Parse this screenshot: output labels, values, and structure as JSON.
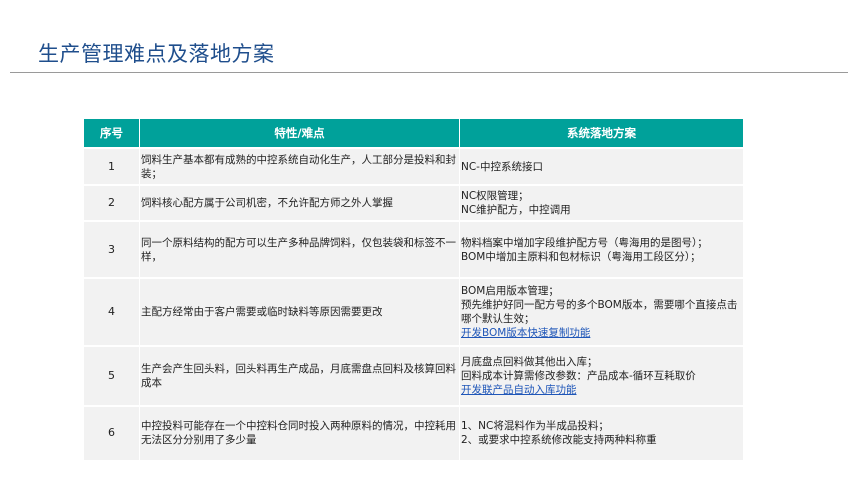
{
  "header": {
    "title": "生产管理难点及落地方案"
  },
  "table": {
    "columns": [
      "序号",
      "特性/难点",
      "系统落地方案"
    ],
    "rows": [
      {
        "no": "1",
        "feature": "饲料生产基本都有成熟的中控系统自动化生产，人工部分是投料和封装；",
        "solution": [
          "NC-中控系统接口"
        ],
        "link": ""
      },
      {
        "no": "2",
        "feature": "饲料核心配方属于公司机密，不允许配方师之外人掌握",
        "solution": [
          "NC权限管理；",
          "NC维护配方，中控调用"
        ],
        "link": ""
      },
      {
        "no": "3",
        "feature": "同一个原料结构的配方可以生产多种品牌饲料，仅包装袋和标签不一样，",
        "solution": [
          "物料档案中增加字段维护配方号（粤海用的是图号）；",
          "BOM中增加主原料和包材标识（粤海用工段区分）；"
        ],
        "link": ""
      },
      {
        "no": "4",
        "feature": "主配方经常由于客户需要或临时缺料等原因需要更改",
        "solution": [
          "BOM启用版本管理；",
          "预先维护好同一配方号的多个BOM版本，需要哪个直接点击哪个默认生效；"
        ],
        "link": "开发BOM版本快速复制功能"
      },
      {
        "no": "5",
        "feature": "生产会产生回头料，回头料再生产成品，月底需盘点回料及核算回料成本",
        "solution": [
          "月底盘点回料做其他出入库；",
          "回料成本计算需修改参数：产品成本-循环互耗取价"
        ],
        "link": "开发联产品自动入库功能"
      },
      {
        "no": "6",
        "feature": "中控投料可能存在一个中控料仓同时投入两种原料的情况，中控耗用无法区分分别用了多少量",
        "solution": [
          "1、NC将混料作为半成品投料；",
          "2、或要求中控系统修改能支持两种料称重"
        ],
        "link": ""
      }
    ]
  }
}
